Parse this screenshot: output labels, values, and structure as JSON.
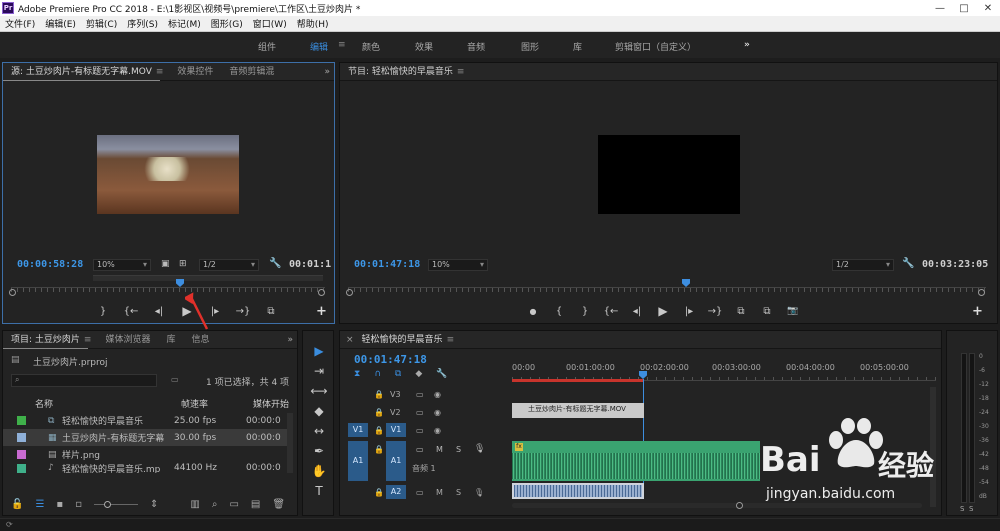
{
  "app": {
    "title": "Adobe Premiere Pro CC 2018 - E:\\1影视区\\视频号\\premiere\\工作区\\土豆炒肉片 *",
    "logo_text": "Pr",
    "win_min": "—",
    "win_max": "□",
    "win_close": "✕"
  },
  "menu": {
    "items": [
      "文件(F)",
      "编辑(E)",
      "剪辑(C)",
      "序列(S)",
      "标记(M)",
      "图形(G)",
      "窗口(W)",
      "帮助(H)"
    ]
  },
  "workspaces": {
    "items": [
      "组件",
      "编辑",
      "颜色",
      "效果",
      "音频",
      "图形",
      "库",
      "剪辑窗口（自定义）"
    ],
    "active": "编辑",
    "more": "»"
  },
  "source_panel": {
    "tabs": [
      "源: 土豆炒肉片-有标题无字幕.MOV",
      "效果控件",
      "音频剪辑混"
    ],
    "timecode": "00:00:58:28",
    "zoom": "10%",
    "resolution": "1/2",
    "duration": "00:01:1",
    "controls": [
      "}",
      "{←",
      "◂|",
      "▶",
      "|▸",
      "→}",
      "⧉"
    ],
    "add": "+"
  },
  "program_panel": {
    "tabs": [
      "节目: 轻松愉快的早晨音乐"
    ],
    "timecode": "00:01:47:18",
    "zoom": "10%",
    "resolution": "1/2",
    "duration": "00:03:23:05",
    "controls": [
      "●",
      "{",
      "}",
      "{←",
      "◂|",
      "▶",
      "|▸",
      "→}",
      "⧉",
      "⧉",
      "📷"
    ],
    "add": "+"
  },
  "project_panel": {
    "tabs": [
      "项目: 土豆炒肉片",
      "媒体浏览器",
      "库",
      "信息"
    ],
    "project_file": "土豆炒肉片.prproj",
    "selection_text": "1 项已选择，共 4 项",
    "columns": [
      "名称",
      "帧速率",
      "媒体开始"
    ],
    "items": [
      {
        "name": "轻松愉快的早晨音乐",
        "fps": "25.00 fps",
        "start": "00:00:0",
        "color": "#3fb04a"
      },
      {
        "name": "土豆炒肉片-有标题无字幕",
        "fps": "30.00 fps",
        "start": "00:00:0",
        "color": "#8fb0d8"
      },
      {
        "name": "样片.png",
        "fps": "",
        "start": "",
        "color": "#c86ad0"
      },
      {
        "name": "轻松愉快的早晨音乐.mp",
        "fps": "44100 Hz",
        "start": "00:00:0",
        "color": "#3fb08a"
      }
    ]
  },
  "timeline": {
    "title": "轻松愉快的早晨音乐",
    "close": "×",
    "timecode": "00:01:47:18",
    "ruler": [
      "00:00",
      "00:01:00:00",
      "00:02:00:00",
      "00:03:00:00",
      "00:04:00:00",
      "00:05:00:00"
    ],
    "tracks": [
      {
        "id": "V3",
        "kind": "video"
      },
      {
        "id": "V2",
        "kind": "video"
      },
      {
        "id": "V1",
        "kind": "video"
      },
      {
        "id": "A1",
        "kind": "audio",
        "name": "音频 1"
      },
      {
        "id": "A2",
        "kind": "audio"
      }
    ],
    "video_clip": "土豆炒肉片-有标题无字幕.MOV",
    "audio_clip_label": "fx",
    "track_mute": "M",
    "track_solo": "S"
  },
  "meters": {
    "labels": [
      "0",
      "-6",
      "-12",
      "-18",
      "-24",
      "-30",
      "-36",
      "-42",
      "-48",
      "-54",
      "dB"
    ],
    "solo_buttons": [
      "S",
      "S"
    ]
  },
  "tools": [
    "▶",
    "⇥",
    "⟷",
    "◆",
    "↔",
    "✒",
    "✋",
    "T"
  ],
  "watermark": {
    "brand": "Bai",
    "brand_cn": "经验",
    "url": "jingyan.baidu.com"
  },
  "colors": {
    "accent": "#3d8ee0",
    "audio_clip": "#3aa370",
    "track_label": "#2b5b8a",
    "background": "#1d1d1d"
  }
}
